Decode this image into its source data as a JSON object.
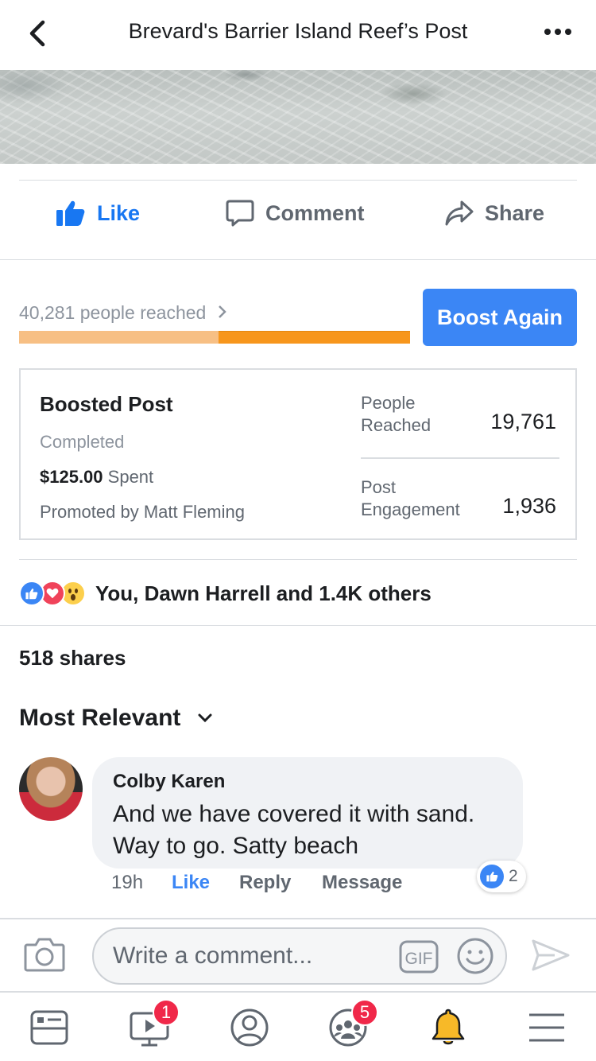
{
  "header": {
    "title": "Brevard's Barrier Island Reef’s Post",
    "back_icon": "back-chevron-icon",
    "more_icon": "more-dots-icon"
  },
  "actions": {
    "like": "Like",
    "comment": "Comment",
    "share": "Share"
  },
  "boost": {
    "reached_label": "40,281 people reached",
    "reached_fraction": 0.49,
    "button_label": "Boost Again"
  },
  "boost_card": {
    "title": "Boosted Post",
    "status": "Completed",
    "spent_amount": "$125.00",
    "spent_label": "Spent",
    "promoted_by": "Promoted by Matt Fleming",
    "people_reached_label": "People Reached",
    "people_reached_value": "19,761",
    "engagement_label": "Post Engagement",
    "engagement_value": "1,936"
  },
  "reactions": {
    "text": "You, Dawn Harrell and 1.4K others"
  },
  "shares": {
    "text": "518 shares"
  },
  "sort": {
    "label": "Most Relevant"
  },
  "comment": {
    "author": "Colby Karen",
    "text": "And we have covered it with sand. Way to go. Satty beach",
    "time": "19h",
    "like": "Like",
    "reply": "Reply",
    "message": "Message",
    "reaction_count": "2"
  },
  "composer": {
    "placeholder": "Write a comment...",
    "gif_label": "GIF"
  },
  "tabbar": {
    "watch_badge": "1",
    "groups_badge": "5"
  },
  "colors": {
    "accent": "#1877f2",
    "boost_button": "#3b86f5",
    "progress_filled": "#f7961c",
    "progress_track": "#f7bf84",
    "badge": "#f02849",
    "bell": "#f7b928"
  }
}
